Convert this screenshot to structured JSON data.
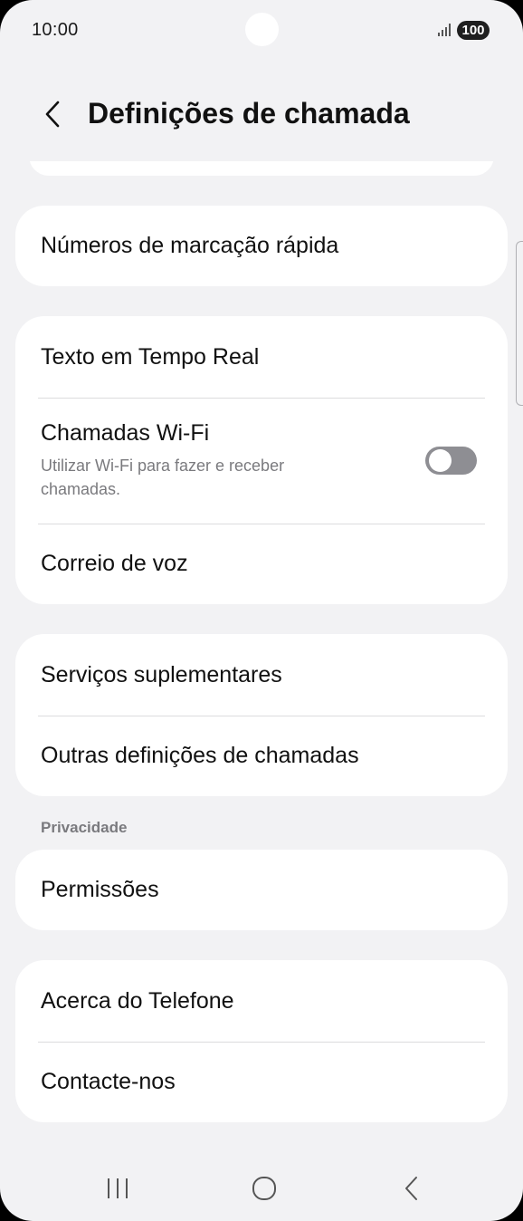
{
  "status_bar": {
    "time": "10:00",
    "battery": "100",
    "signal_icon": "signal-icon"
  },
  "header": {
    "title": "Definições de chamada",
    "back_icon": "chevron-left-icon"
  },
  "cards": {
    "speed_dial": {
      "label": "Números de marcação rápida"
    },
    "group2": {
      "rtt": "Texto em Tempo Real",
      "wifi_calling": {
        "label": "Chamadas Wi-Fi",
        "sub": "Utilizar Wi-Fi para fazer e receber chamadas.",
        "enabled": false
      },
      "voicemail": "Correio de voz"
    },
    "group3": {
      "supplementary": "Serviços suplementares",
      "other": "Outras definições de chamadas"
    },
    "privacy_section": "Privacidade",
    "permissions": "Permissões",
    "group5": {
      "about": "Acerca do Telefone",
      "contact": "Contacte-nos"
    }
  },
  "nav_bar": {
    "recent_icon": "recent-apps-icon",
    "home_icon": "home-icon",
    "back_icon": "back-icon"
  },
  "colors": {
    "background": "#f2f2f4",
    "card": "#ffffff",
    "toggle_off": "#8e8e93"
  }
}
